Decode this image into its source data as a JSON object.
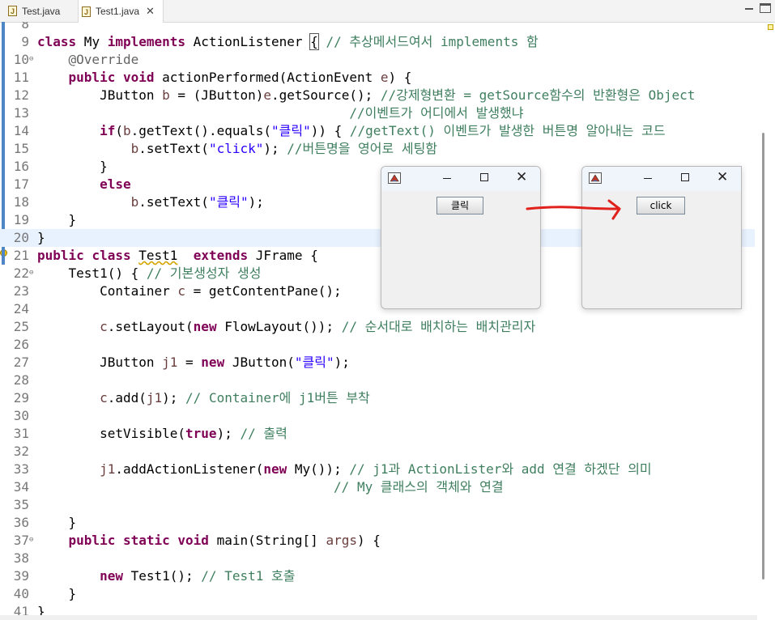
{
  "tabs": [
    {
      "label": "Test.java",
      "active": false,
      "icon": "java-file-icon"
    },
    {
      "label": "Test1.java",
      "active": true,
      "icon": "java-file-icon",
      "close": "✕"
    }
  ],
  "editor": {
    "lines": [
      {
        "num": "8",
        "html": ""
      },
      {
        "num": "9",
        "html": "<span class=\"kw\">class</span> My <span class=\"kw\">implements</span> ActionListener <span style=\"outline:1px solid #555\">{</span> <span class=\"cm\">// 추상메서드여서 implements 함</span>"
      },
      {
        "num": "10",
        "fold": "⊖",
        "html": "    <span class=\"an\">@Override</span>"
      },
      {
        "num": "11",
        "html": "    <span class=\"kw\">public</span> <span class=\"kw\">void</span> actionPerformed(ActionEvent <span class=\"vr\">e</span>) {"
      },
      {
        "num": "12",
        "html": "        JButton <span class=\"vr\">b</span> = (JButton)<span class=\"vr\">e</span>.getSource(); <span class=\"cm\">//강제형변환 = getSource함수의 반환형은 Object</span>"
      },
      {
        "num": "13",
        "html": "                                        <span class=\"cm\">//이벤트가 어디에서 발생했냐</span>"
      },
      {
        "num": "14",
        "html": "        <span class=\"kw\">if</span>(<span class=\"vr\">b</span>.getText().equals(<span class=\"st\">\"클릭\"</span>)) { <span class=\"cm\">//getText() 이벤트가 발생한 버튼명 알아내는 코드</span>"
      },
      {
        "num": "15",
        "html": "            <span class=\"vr\">b</span>.setText(<span class=\"st\">\"click\"</span>); <span class=\"cm\">//버튼명을 영어로 세팅함</span>"
      },
      {
        "num": "16",
        "html": "        }"
      },
      {
        "num": "17",
        "html": "        <span class=\"kw\">else</span>"
      },
      {
        "num": "18",
        "html": "            <span class=\"vr\">b</span>.setText(<span class=\"st\">\"클릭\"</span>);"
      },
      {
        "num": "19",
        "html": "    }"
      },
      {
        "num": "20",
        "html": "}",
        "highlight": true
      },
      {
        "num": "21",
        "warn": true,
        "html": "<span class=\"kw\">public</span> <span class=\"kw\">class</span> <span style=\"text-decoration:underline wavy #d4a500\">Test1</span>  <span class=\"kw\">extends</span> JFrame {"
      },
      {
        "num": "22",
        "fold": "⊖",
        "html": "    Test1() { <span class=\"cm\">// 기본생성자 생성</span>"
      },
      {
        "num": "23",
        "html": "        Container <span class=\"vr\">c</span> = getContentPane();"
      },
      {
        "num": "24",
        "html": ""
      },
      {
        "num": "25",
        "html": "        <span class=\"vr\">c</span>.setLayout(<span class=\"kw\">new</span> FlowLayout()); <span class=\"cm\">// 순서대로 배치하는 배치관리자</span>"
      },
      {
        "num": "26",
        "html": ""
      },
      {
        "num": "27",
        "html": "        JButton <span class=\"vr\">j1</span> = <span class=\"kw\">new</span> JButton(<span class=\"st\">\"클릭\"</span>);"
      },
      {
        "num": "28",
        "html": ""
      },
      {
        "num": "29",
        "html": "        <span class=\"vr\">c</span>.add(<span class=\"vr\">j1</span>); <span class=\"cm\">// Container에 j1버튼 부착</span>"
      },
      {
        "num": "30",
        "html": ""
      },
      {
        "num": "31",
        "html": "        setVisible(<span class=\"kw\">true</span>); <span class=\"cm\">// 출력</span>"
      },
      {
        "num": "32",
        "html": ""
      },
      {
        "num": "33",
        "html": "        <span class=\"vr\">j1</span>.addActionListener(<span class=\"kw\">new</span> My()); <span class=\"cm\">// j1과 ActionLister와 add 연결 하겠단 의미</span>"
      },
      {
        "num": "34",
        "html": "                                      <span class=\"cm\">// My 클래스의 객체와 연결</span>"
      },
      {
        "num": "35",
        "html": ""
      },
      {
        "num": "36",
        "html": "    }"
      },
      {
        "num": "37",
        "fold": "⊖",
        "html": "    <span class=\"kw\">public</span> <span class=\"kw\">static</span> <span class=\"kw\">void</span> main(String[] <span class=\"vr\">args</span>) {"
      },
      {
        "num": "38",
        "html": ""
      },
      {
        "num": "39",
        "html": "        <span class=\"kw\">new</span> Test1(); <span class=\"cm\">// Test1 호출</span>"
      },
      {
        "num": "40",
        "html": "    }"
      },
      {
        "num": "41",
        "html": "}"
      }
    ]
  },
  "popups": [
    {
      "button": "클릭",
      "min": "–",
      "close": "✕"
    },
    {
      "button": "click",
      "min": "–",
      "close": "✕"
    }
  ],
  "arrow_color": "#e0211c",
  "colors": {
    "keyword": "#7f0055",
    "comment": "#3f7f5f",
    "string": "#2a00ff",
    "highlight": "#e8f2fe"
  }
}
